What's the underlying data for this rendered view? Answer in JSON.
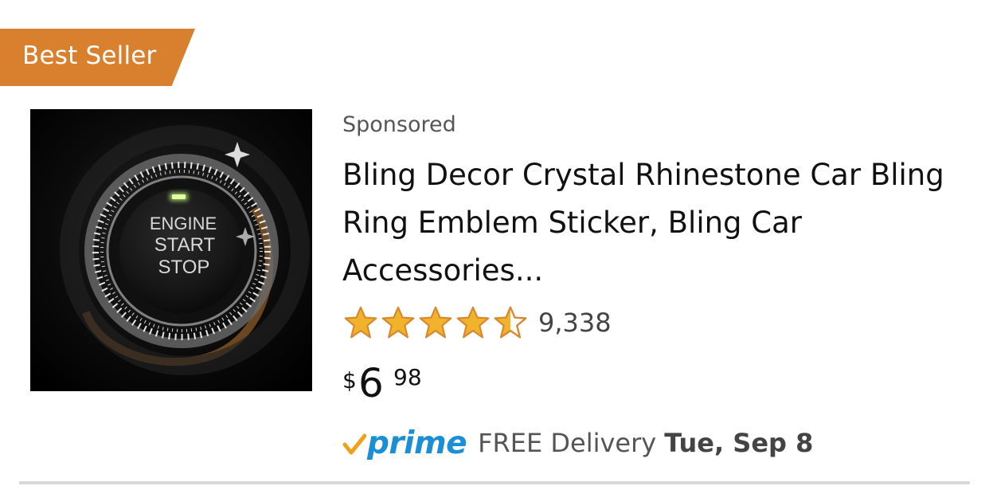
{
  "badge": {
    "label": "Best Seller",
    "color": "#d9802f"
  },
  "product": {
    "image": {
      "alt": "",
      "button_text": [
        "ENGINE",
        "START",
        "STOP"
      ]
    },
    "sponsored_label": "Sponsored",
    "title": "Bling Decor Crystal Rhinestone Car Bling Ring Emblem Sticker, Bling Car Accessories...",
    "rating": {
      "stars": 4.5,
      "max_stars": 5,
      "review_count": "9,338",
      "star_color": "#f0b32b"
    },
    "price": {
      "currency": "$",
      "whole": "6",
      "fraction": "98"
    },
    "delivery": {
      "prime_label": "prime",
      "prime_color": "#1b8fd6",
      "check_color": "#f0a11b",
      "text": "FREE Delivery",
      "date": "Tue, Sep 8"
    }
  },
  "icons": {
    "star": "star-icon",
    "half_star": "half-star-icon",
    "empty_star": "empty-star-icon",
    "prime_check": "prime-check-icon"
  }
}
